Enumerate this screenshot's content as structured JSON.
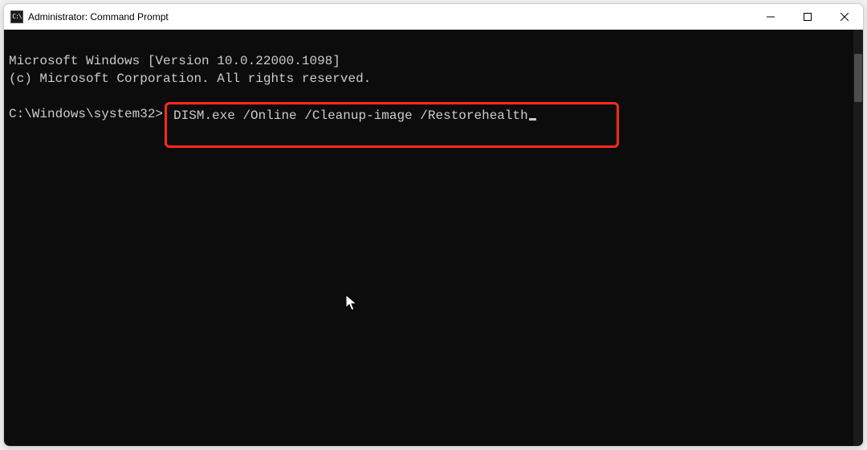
{
  "titlebar": {
    "icon_text": "C:\\",
    "title": "Administrator: Command Prompt"
  },
  "terminal": {
    "line1": "Microsoft Windows [Version 10.0.22000.1098]",
    "line2": "(c) Microsoft Corporation. All rights reserved.",
    "blank": "",
    "prompt": "C:\\Windows\\system32>",
    "command": "DISM.exe /Online /Cleanup-image /Restorehealth"
  }
}
